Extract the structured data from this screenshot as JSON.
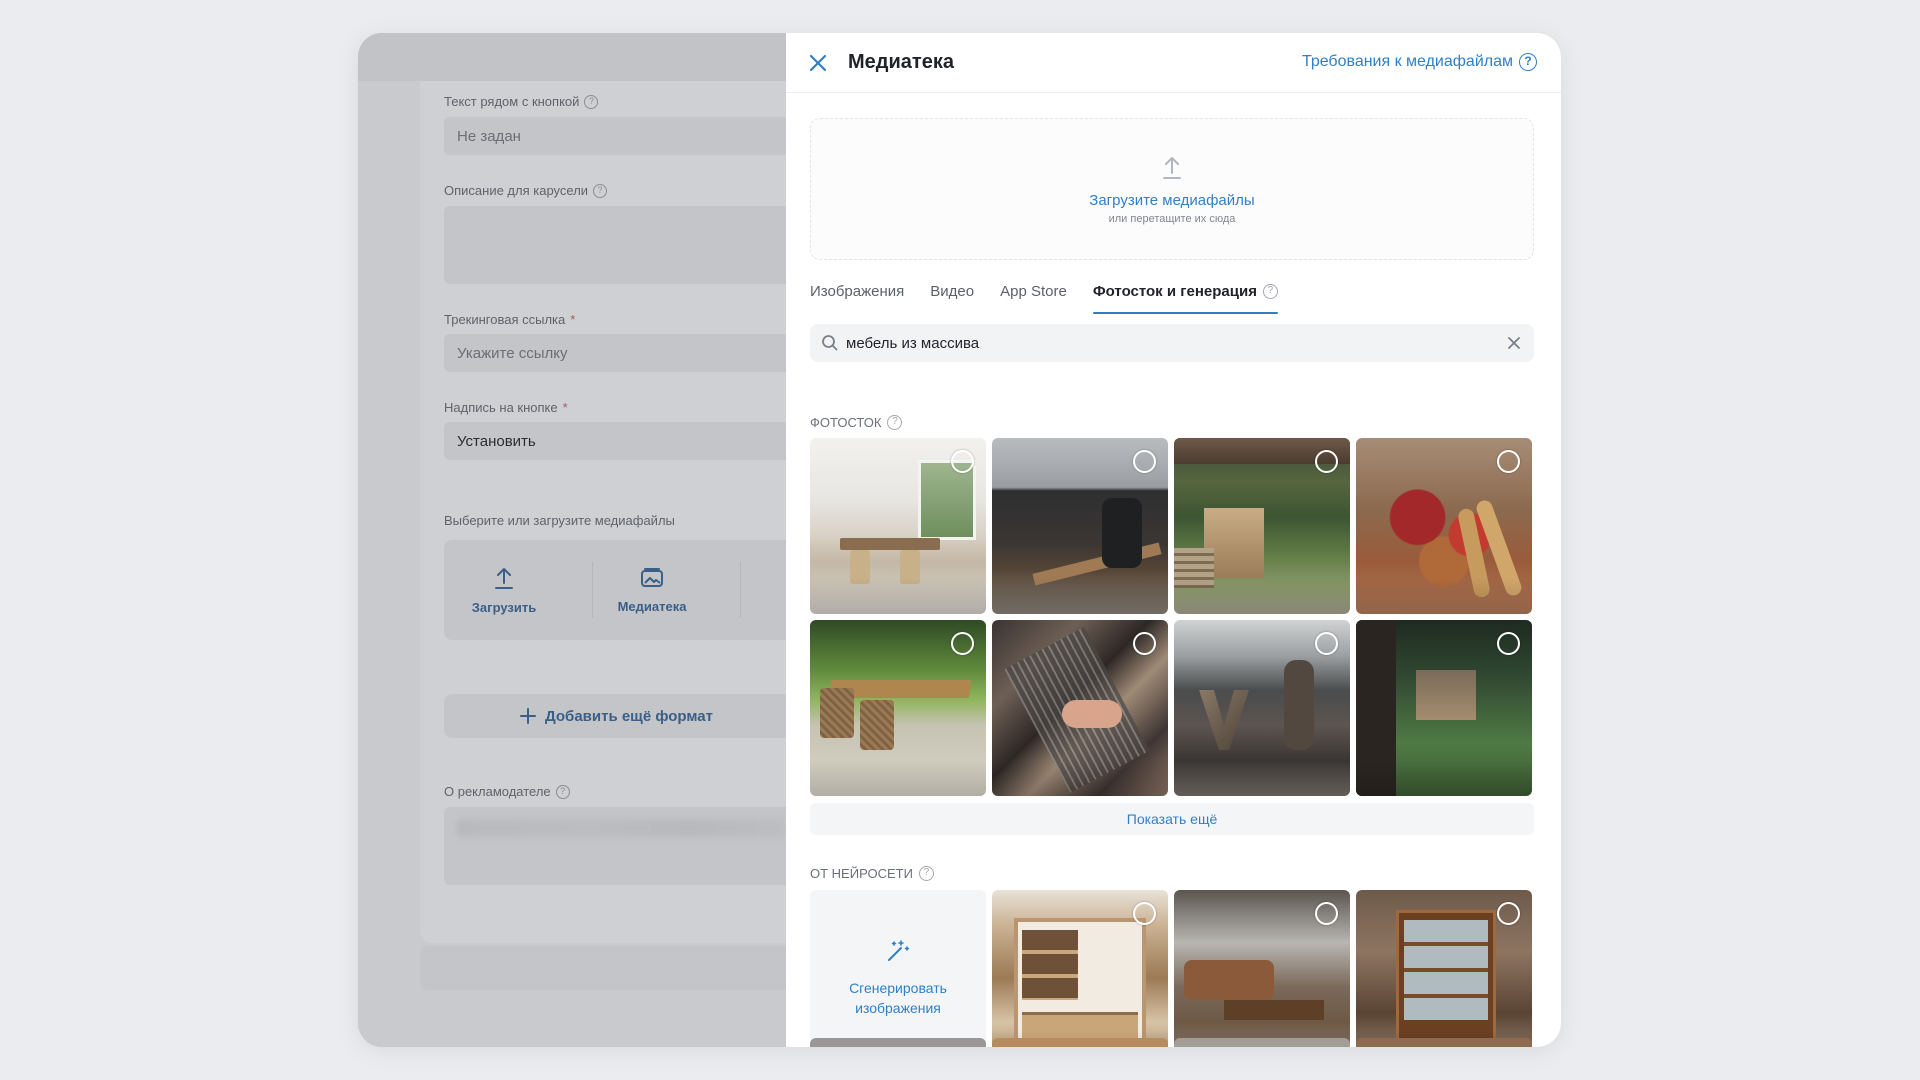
{
  "background_form": {
    "text_near_button_label": "Текст рядом с кнопкой",
    "text_near_button_value": "Не задан",
    "carousel_description_label": "Описание для карусели",
    "tracking_link_label": "Трекинговая ссылка",
    "tracking_link_placeholder": "Укажите ссылку",
    "button_caption_label": "Надпись на кнопке",
    "button_caption_value": "Установить",
    "media_select_label": "Выберите или загрузите медиафайлы",
    "upload_label": "Загрузить",
    "library_label": "Медиатека",
    "add_format_label": "Добавить ещё формат",
    "advertiser_label": "О рекламодателе",
    "required_mark": "*"
  },
  "modal": {
    "title": "Медиатека",
    "requirements_link": "Требования к медиафайлам",
    "dropzone": {
      "title": "Загрузите медиафайлы",
      "subtitle": "или перетащите их сюда"
    },
    "tabs": [
      {
        "label": "Изображения",
        "active": false
      },
      {
        "label": "Видео",
        "active": false
      },
      {
        "label": "App Store",
        "active": false
      },
      {
        "label": "Фотосток и генерация",
        "active": true
      }
    ],
    "search": {
      "value": "мебель из массива"
    },
    "photostock": {
      "label": "ФОТОСТОК",
      "show_more": "Показать ещё"
    },
    "neural": {
      "label": "ОТ НЕЙРОСЕТИ",
      "generate_label": "Сгенерировать изображения"
    }
  },
  "colors": {
    "accent": "#2f7fc7",
    "text": "#1f2329",
    "muted": "#6b7078",
    "overlay": "#cbccd0"
  },
  "icons": {
    "close": "close-icon",
    "help": "help-icon",
    "upload": "upload-icon",
    "search": "search-icon",
    "clear": "clear-icon",
    "magic_wand": "magic-wand-icon",
    "select": "select-circle-icon"
  }
}
